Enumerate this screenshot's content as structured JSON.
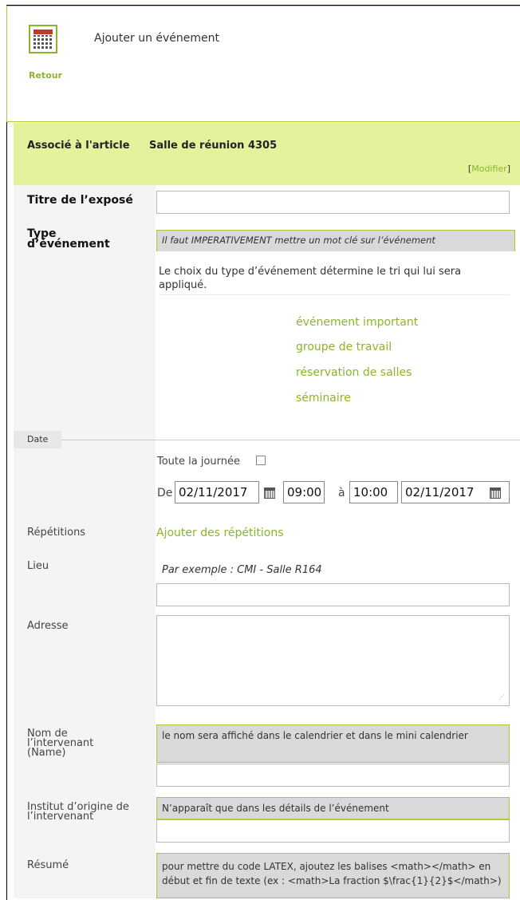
{
  "header": {
    "title": "Ajouter un événement",
    "back_label": "Retour"
  },
  "association": {
    "label": "Associé à l'article",
    "value": "Salle de réunion 4305",
    "modify_open": "[",
    "modify_label": "Modifier",
    "modify_close": "]"
  },
  "fields": {
    "title": {
      "label": "Titre de l’exposé",
      "value": ""
    },
    "type": {
      "label_line1": "Type",
      "label_line2": "d’événement",
      "hint": "Il faut IMPERATIVEMENT mettre un mot clé sur l’événement",
      "description": "Le choix du type d’événement détermine le tri qui lui sera appliqué.",
      "keywords": [
        "événement important",
        "groupe de travail",
        "réservation de salles",
        "séminaire"
      ]
    },
    "date": {
      "section_label": "Date",
      "all_day_label": "Toute la journée",
      "from_label": "De",
      "to_label": "à",
      "start_date": "02/11/2017",
      "start_time": "09:00",
      "end_time": "10:00",
      "end_date": "02/11/2017"
    },
    "repetitions": {
      "label": "Répétitions",
      "link": "Ajouter des répétitions"
    },
    "place": {
      "label": "Lieu",
      "example": "Par exemple : CMI - Salle R164",
      "value": ""
    },
    "address": {
      "label": "Adresse",
      "value": ""
    },
    "speaker": {
      "label_line1": "Nom de",
      "label_line2": "l’intervenant",
      "label_line3": "(Name)",
      "hint": "le nom sera affiché dans le calendrier et dans le mini calendrier",
      "value": ""
    },
    "institute": {
      "label_line1": "Institut d’origine de",
      "label_line2": "l’intervenant",
      "hint": "N’apparaît que dans les détails de l’événement",
      "value": ""
    },
    "abstract": {
      "label": "Résumé",
      "hint": "pour mettre du code LATEX, ajoutez les balises <math></math> en début et fin de texte (ex : <math>La fraction $\\frac{1}{2}$</math>)"
    }
  }
}
